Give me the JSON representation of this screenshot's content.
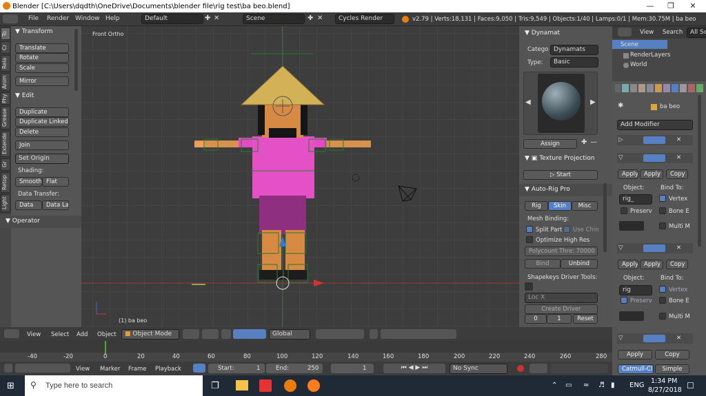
{
  "title": "Blender [C:\\Users\\dqdth\\OneDrive\\Documents\\blender file\\rig test\\ba beo.blend]",
  "menubar": {
    "file": "File",
    "render": "Render",
    "window": "Window",
    "help": "Help",
    "layout": "Default",
    "scene": "Scene",
    "engine": "Cycles Render",
    "stats": "v2.79 | Verts:18,131 | Faces:9,050 | Tris:9,549 | Objects:1/40 | Lamps:0/1 | Mem:30.75M | ba beo"
  },
  "tabs": [
    "To",
    "Cr",
    "Rela",
    "Anim",
    "Phy",
    "Grease",
    "Extende",
    "Gr",
    "Retop",
    "Light"
  ],
  "toolshelf": {
    "transform": "Transform",
    "translate": "Translate",
    "rotate": "Rotate",
    "scale": "Scale",
    "mirror": "Mirror",
    "edit": "Edit",
    "duplicate": "Duplicate",
    "duplicate_linked": "Duplicate Linked",
    "delete": "Delete",
    "join": "Join",
    "set_origin": "Set Origin",
    "shading": "Shading:",
    "smooth": "Smooth",
    "flat": "Flat",
    "data_transfer": "Data Transfer:",
    "data": "Data",
    "data_la": "Data La",
    "operator": "Operator"
  },
  "viewport": {
    "view_name": "Front Ortho",
    "object_label": "(1) ba beo"
  },
  "dynamat": {
    "header": "Dynamat",
    "category_label": "Catego",
    "category": "Dynamats",
    "type_label": "Type:",
    "type": "Basic",
    "assign": "Assign"
  },
  "texture_projection": {
    "header": "Texture Projection",
    "start": "Start"
  },
  "autorig": {
    "header": "Auto-Rig Pro",
    "tab_rig": "Rig",
    "tab_skin": "Skin",
    "tab_misc": "Misc",
    "mesh_binding": "Mesh Binding:",
    "split_parts": "Split Part",
    "use_chin": "Use Chin",
    "optimize": "Optimize High Res",
    "polycount": "Polycount Thre: 70000",
    "bind": "Bind",
    "unbind": "Unbind",
    "shapekeys": "Shapekeys Driver Tools:",
    "loc_x": "Loc X",
    "create_driver": "Create Driver",
    "val0": "0",
    "val1": "1",
    "reset": "Reset"
  },
  "outliner": {
    "view": "View",
    "search": "Search",
    "all_scenes": "All Sc",
    "scene": "Scene",
    "renderlayers": "RenderLayers",
    "world": "World"
  },
  "properties": {
    "object_name": "ba beo",
    "add_modifier": "Add Modifier",
    "apply": "Apply",
    "apply_as": "Apply a",
    "copy": "Copy",
    "object": "Object:",
    "bind_to": "Bind To:",
    "rig_field_1": "rig_",
    "rig_field_2": "rig",
    "vertex": "Vertex",
    "preserve": "Preserv",
    "bone_e": "Bone E",
    "multi_m": "Multi M",
    "catmull": "Catmull-Cl",
    "simple": "Simple"
  },
  "header3d": {
    "view": "View",
    "select": "Select",
    "add": "Add",
    "object": "Object",
    "mode": "Object Mode",
    "orientation": "Global"
  },
  "timeline": {
    "ticks": [
      "-40",
      "-20",
      "0",
      "20",
      "40",
      "60",
      "80",
      "100",
      "120",
      "140",
      "160",
      "180",
      "200",
      "220",
      "240",
      "260",
      "280"
    ],
    "view": "View",
    "marker": "Marker",
    "frame": "Frame",
    "playback": "Playback",
    "start_label": "Start:",
    "start": "1",
    "end_label": "End:",
    "end": "250",
    "current": "1",
    "sync": "No Sync"
  },
  "taskbar": {
    "search": "Type here to search",
    "lang": "ENG",
    "time": "1:34 PM",
    "date": "8/27/2018"
  }
}
